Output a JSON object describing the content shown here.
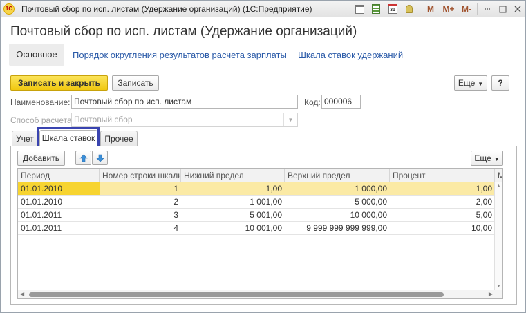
{
  "window": {
    "title": "Почтовый сбор по исп. листам (Удержание организаций)  (1С:Предприятие)",
    "logo_text": "1С",
    "toolbar_icons": [
      "save-doc-icon",
      "calculator-icon",
      "calendar-icon",
      "bell-icon"
    ],
    "calendar_day": "31",
    "m_buttons": [
      "M",
      "M+",
      "M-"
    ]
  },
  "form": {
    "title": "Почтовый сбор по исп. листам (Удержание организаций)",
    "nav": {
      "main": "Основное",
      "links": [
        "Порядок округления результатов расчета зарплаты",
        "Шкала ставок удержаний"
      ]
    },
    "commands": {
      "save_close": "Записать и закрыть",
      "save": "Записать",
      "more": "Еще",
      "help": "?"
    },
    "fields": {
      "name_label": "Наименование:",
      "name_value": "Почтовый сбор по исп. листам",
      "code_label": "Код:",
      "code_value": "000006",
      "method_label": "Способ расчета:",
      "method_value": "Почтовый сбор"
    },
    "tabs": [
      "Учет",
      "Шкала ставок",
      "Прочее"
    ],
    "active_tab": 1
  },
  "table": {
    "add_label": "Добавить",
    "more": "Еще",
    "columns": [
      "Период",
      "Номер строки шкалы",
      "Нижний предел",
      "Верхний предел",
      "Процент",
      "М"
    ],
    "rows": [
      [
        "01.01.2010",
        "1",
        "1,00",
        "1 000,00",
        "1,00"
      ],
      [
        "01.01.2010",
        "2",
        "1 001,00",
        "5 000,00",
        "2,00"
      ],
      [
        "01.01.2011",
        "3",
        "5 001,00",
        "10 000,00",
        "5,00"
      ],
      [
        "01.01.2011",
        "4",
        "10 001,00",
        "9 999 999 999 999,00",
        "10,00"
      ]
    ],
    "selected_row": 0
  }
}
